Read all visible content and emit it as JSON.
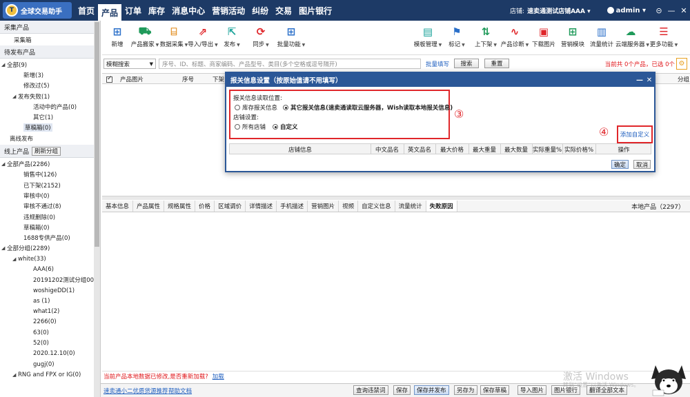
{
  "app": {
    "logo_text": "全球交易助手",
    "logo_mark": "T"
  },
  "nav": [
    "首页",
    "产品",
    "订单",
    "库存",
    "消息中心",
    "营销活动",
    "纠纷",
    "交易",
    "图片银行"
  ],
  "topright": {
    "store_label": "店铺:",
    "store_name": "速卖通测试店铺AAA ▾",
    "user": "admin ▾",
    "controls": [
      "⊝",
      "—",
      "✕"
    ]
  },
  "sidebar": {
    "sec_collect": "采集产品",
    "collect_box": "采集箱",
    "sec_pending": "待发布产品",
    "pending": [
      {
        "label": "全部(9)",
        "caret": "◢",
        "indent": 2
      },
      {
        "label": "新增(3)",
        "caret": "",
        "indent": 26
      },
      {
        "label": "修改过(5)",
        "caret": "",
        "indent": 26
      },
      {
        "label": "发布失败(1)",
        "caret": "◢",
        "indent": 18
      },
      {
        "label": "活动中的产品(0)",
        "caret": "",
        "indent": 40
      },
      {
        "label": "其它(1)",
        "caret": "",
        "indent": 40
      },
      {
        "label": "草稿箱(0)",
        "caret": "",
        "indent": 26,
        "selected": true
      },
      {
        "label": "离线发布",
        "caret": "",
        "indent": 6
      }
    ],
    "sec_online": "线上产品",
    "refresh_btn": "刷新分组",
    "online": [
      {
        "label": "全部产品(2286)",
        "caret": "◢",
        "indent": 2
      },
      {
        "label": "销售中(126)",
        "caret": "",
        "indent": 26
      },
      {
        "label": "已下架(2152)",
        "caret": "",
        "indent": 26
      },
      {
        "label": "审核中(0)",
        "caret": "",
        "indent": 26
      },
      {
        "label": "审核不通过(8)",
        "caret": "",
        "indent": 26
      },
      {
        "label": "违规删除(0)",
        "caret": "",
        "indent": 26
      },
      {
        "label": "草稿箱(0)",
        "caret": "",
        "indent": 26
      },
      {
        "label": "1688专供产品(0)",
        "caret": "",
        "indent": 26
      },
      {
        "label": "全部分组(2289)",
        "caret": "◢",
        "indent": 2
      },
      {
        "label": "white(33)",
        "caret": "◢",
        "indent": 18
      },
      {
        "label": "AAA(6)",
        "caret": "",
        "indent": 40
      },
      {
        "label": "20191202测试分组00'",
        "caret": "",
        "indent": 40
      },
      {
        "label": "woshigeDD(1)",
        "caret": "",
        "indent": 40
      },
      {
        "label": "as (1)",
        "caret": "",
        "indent": 40
      },
      {
        "label": "what1(2)",
        "caret": "",
        "indent": 40
      },
      {
        "label": "2266(0)",
        "caret": "",
        "indent": 40
      },
      {
        "label": "63(0)",
        "caret": "",
        "indent": 40
      },
      {
        "label": "52(0)",
        "caret": "",
        "indent": 40
      },
      {
        "label": "2020.12.10(0)",
        "caret": "",
        "indent": 40
      },
      {
        "label": "gugj(0)",
        "caret": "",
        "indent": 40
      },
      {
        "label": "RNG and FPX or IG(0)",
        "caret": "◢",
        "indent": 18
      }
    ]
  },
  "toolbar": {
    "left": [
      {
        "label": "新增",
        "icon": "plus-grid-icon",
        "glyph": "⊞",
        "color": "#2a6fc9"
      },
      {
        "label": "产品搬家",
        "icon": "truck-icon",
        "glyph": "⛟",
        "color": "#1f9a5a",
        "dd": true
      },
      {
        "label": "数据采集",
        "icon": "collect-icon",
        "glyph": "⌸",
        "color": "#e08a1a",
        "dd": true
      },
      {
        "label": "导入/导出",
        "icon": "import-export-icon",
        "glyph": "⇗",
        "color": "#e0262a",
        "dd": true
      },
      {
        "label": "发布",
        "icon": "publish-icon",
        "glyph": "⇱",
        "color": "#1aa39a",
        "dd": true
      },
      {
        "label": "同步",
        "icon": "sync-icon",
        "glyph": "⟳",
        "color": "#e0262a",
        "dd": true
      },
      {
        "label": "批量功能",
        "icon": "batch-icon",
        "glyph": "⊞",
        "color": "#2a6fc9",
        "dd": true
      }
    ],
    "right": [
      {
        "label": "模板管理",
        "icon": "template-icon",
        "glyph": "▤",
        "color": "#1aa39a",
        "dd": true
      },
      {
        "label": "标记",
        "icon": "flag-icon",
        "glyph": "⚑",
        "color": "#2a6fc9",
        "dd": true
      },
      {
        "label": "上下架",
        "icon": "shelf-icon",
        "glyph": "⇅",
        "color": "#1f9a5a",
        "dd": true
      },
      {
        "label": "产品诊断",
        "icon": "diagnose-icon",
        "glyph": "∿",
        "color": "#e0262a",
        "dd": true
      },
      {
        "label": "下载图片",
        "icon": "download-image-icon",
        "glyph": "▣",
        "color": "#e0262a"
      },
      {
        "label": "营销模块",
        "icon": "marketing-icon",
        "glyph": "⊞",
        "color": "#1f9a5a"
      },
      {
        "label": "流量统计",
        "icon": "traffic-icon",
        "glyph": "▥",
        "color": "#2a6fc9"
      },
      {
        "label": "云端服务器",
        "icon": "cloud-icon",
        "glyph": "☁",
        "color": "#1f9a5a",
        "dd": true
      },
      {
        "label": "更多功能",
        "icon": "menu-icon",
        "glyph": "☰",
        "color": "#e0262a",
        "dd": true
      }
    ]
  },
  "search": {
    "mode": "模糊搜索",
    "placeholder": "序号、ID、标题、商家编码、产品型号、类目(多个空格或逗号隔开)",
    "batch_fill": "批量填写",
    "search_btn": "搜索",
    "reset_btn": "重置",
    "summary": "当前共 0个产品，已选 0个"
  },
  "table_header": [
    "产品图片",
    "序号",
    "下架",
    "分组"
  ],
  "tabs": [
    "基本信息",
    "产品属性",
    "规格属性",
    "价格",
    "区域调价",
    "详情描述",
    "手机描述",
    "营销图片",
    "视频",
    "自定义信息",
    "流量统计",
    "失败原因"
  ],
  "active_tab": 11,
  "local_products": "本地产品（2297）",
  "notice": {
    "text": "当前产品本地数据已修改,是否重新加载?",
    "link": "加载"
  },
  "status": {
    "link1": "速卖通小二优质货源推荐",
    "link2": "帮助文档",
    "buttons": [
      "查询违禁词",
      "保存",
      "保存并发布",
      "另存为",
      "保存草稿",
      "导入图片",
      "图片银行",
      "翻译全部文本"
    ],
    "watermark": "激活 Windows",
    "watermark_sub": "转到“设置”以激活 Windows。"
  },
  "dialog": {
    "title": "报关信息设置（按原始值请不用填写）",
    "controls": [
      "—",
      "✕"
    ],
    "read_position_label": "报关信息读取位置:",
    "opt_inventory": "库存报关信息",
    "opt_other": "其它报关信息(速卖通读取云服务器，Wish读取本地报关信息)",
    "store_setting_label": "店铺设置:",
    "opt_all_stores": "所有店铺",
    "opt_custom": "自定义",
    "marker3": "③",
    "marker4": "④",
    "add_custom": "添加自定义",
    "columns": [
      "店铺信息",
      "中文品名",
      "英文品名",
      "最大价格",
      "最大重量",
      "最大数量",
      "实际重量%",
      "实际价格%",
      "操作"
    ],
    "confirm": "确定",
    "cancel": "取消"
  }
}
